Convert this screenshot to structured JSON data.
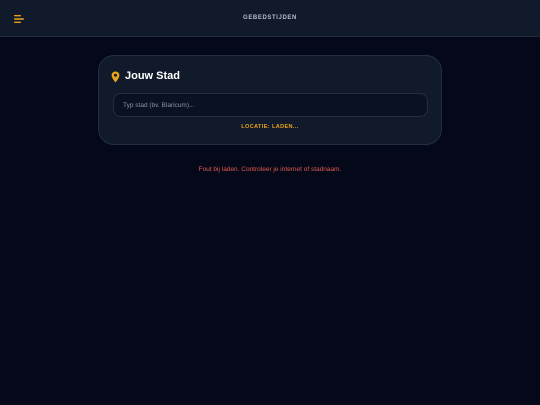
{
  "header": {
    "title": "GEBEDSTIJDEN",
    "menu_icon": "menu-icon"
  },
  "location_card": {
    "icon": "map-pin-icon",
    "title": "Jouw Stad",
    "search": {
      "value": "",
      "placeholder": "Typ stad (bv. Blaricum)..."
    },
    "status": "LOCATIE: LADEN..."
  },
  "error": {
    "message": "Fout bij laden. Controleer je internet of stadnaam."
  },
  "colors": {
    "background": "#040818",
    "panel": "#111a2b",
    "accent": "#e8a317",
    "error": "#e05a4f"
  }
}
